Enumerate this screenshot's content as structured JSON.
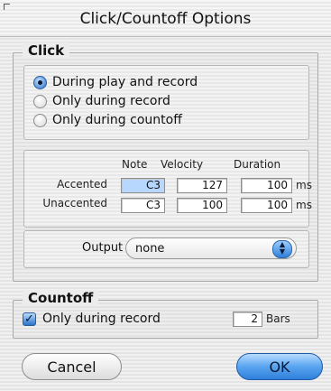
{
  "window": {
    "title": "Click/Countoff Options"
  },
  "click": {
    "title": "Click",
    "radio_options": [
      {
        "label": "During play and record",
        "selected": true
      },
      {
        "label": "Only during record",
        "selected": false
      },
      {
        "label": "Only during countoff",
        "selected": false
      }
    ],
    "table": {
      "columns": {
        "note": "Note",
        "velocity": "Velocity",
        "duration": "Duration"
      },
      "rows": [
        {
          "label": "Accented",
          "note": "C3",
          "velocity": "127",
          "duration": "100",
          "unit": "ms"
        },
        {
          "label": "Unaccented",
          "note": "C3",
          "velocity": "100",
          "duration": "100",
          "unit": "ms"
        }
      ]
    },
    "output": {
      "label": "Output",
      "value": "none"
    }
  },
  "countoff": {
    "title": "Countoff",
    "checkbox": {
      "label": "Only during record",
      "checked": true
    },
    "bars": {
      "value": "2",
      "unit": "Bars"
    }
  },
  "buttons": {
    "cancel": "Cancel",
    "ok": "OK"
  },
  "colors": {
    "accent": "#2f80db",
    "field_highlight": "#b7d7ff"
  }
}
